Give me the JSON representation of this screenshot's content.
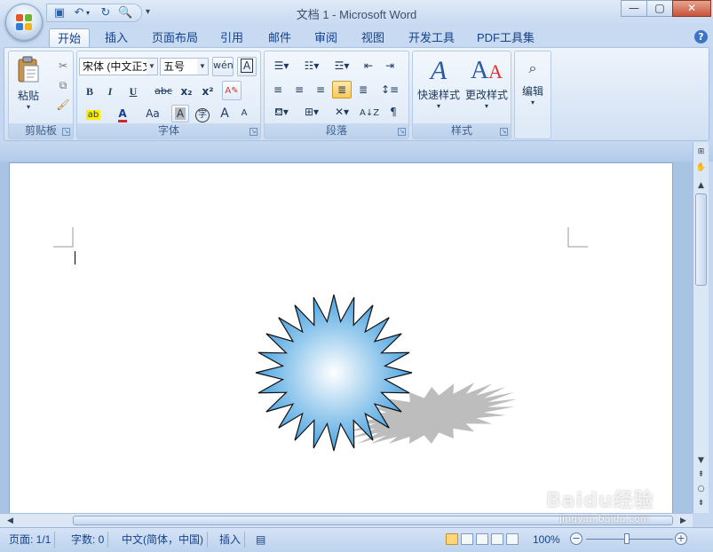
{
  "window": {
    "title": "文档 1 - Microsoft Word",
    "controls": {
      "minimize": "—",
      "maximize": "▢",
      "close": "✕"
    }
  },
  "quick_access": {
    "customize": "▾"
  },
  "tabs": [
    {
      "label": "开始",
      "active": true
    },
    {
      "label": "插入"
    },
    {
      "label": "页面布局"
    },
    {
      "label": "引用"
    },
    {
      "label": "邮件"
    },
    {
      "label": "审阅"
    },
    {
      "label": "视图"
    },
    {
      "label": "开发工具"
    },
    {
      "label": "PDF工具集"
    }
  ],
  "help": "?",
  "ribbon": {
    "clipboard": {
      "paste_label": "粘贴",
      "group_label": "剪贴板"
    },
    "font": {
      "font_name": "宋体 (中文正文",
      "font_size": "五号",
      "bold": "B",
      "italic": "I",
      "underline": "U",
      "strike": "abc",
      "subscript": "x₂",
      "superscript": "x²",
      "font_color": "A",
      "change_case": "Aa",
      "grow": "A",
      "shrink": "A",
      "group_label": "字体"
    },
    "paragraph": {
      "group_label": "段落"
    },
    "styles": {
      "quick_styles": "快速样式",
      "change_styles": "更改样式",
      "group_label": "样式"
    },
    "editing": {
      "label": "编辑"
    }
  },
  "status": {
    "page": "页面: 1/1",
    "words": "字数: 0",
    "language": "中文(简体，中国)",
    "insert_mode": "插入",
    "zoom": "100%",
    "zoom_level_percent": 100
  },
  "watermark": {
    "logo": "Baidu经验",
    "url": "jingyan.baidu.com"
  },
  "colors": {
    "accent": "#15428b",
    "star_outer": "#4aa3e0",
    "star_inner": "#ffffff",
    "shadow": "#bdbdbd"
  }
}
